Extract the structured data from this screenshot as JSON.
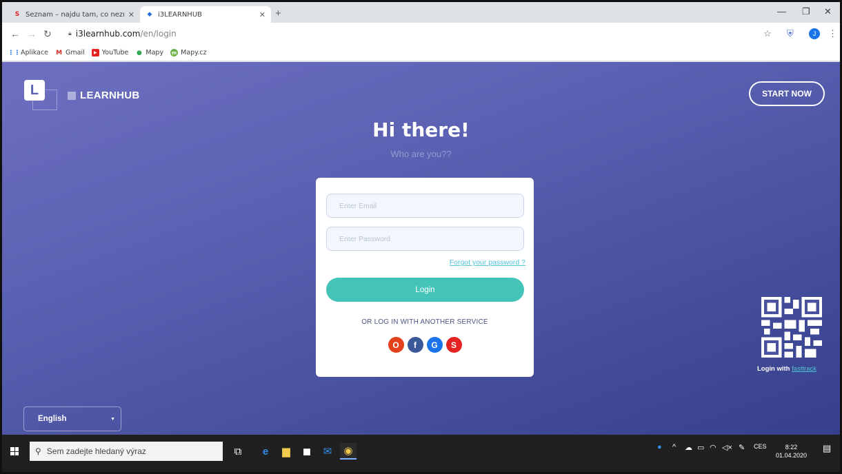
{
  "browser": {
    "tabs": [
      {
        "title": "Seznam – najdu tam, co neznám",
        "favicon": "seznam-icon",
        "active": false
      },
      {
        "title": "i3LEARNHUB",
        "favicon": "i3learnhub-icon",
        "active": true
      }
    ],
    "new_tab": "+",
    "url_host": "i3learnhub.com",
    "url_path": "/en/login",
    "bookmarks": [
      {
        "label": "Aplikace",
        "icon": "apps-grid-icon"
      },
      {
        "label": "Gmail",
        "icon": "gmail-icon"
      },
      {
        "label": "YouTube",
        "icon": "youtube-icon"
      },
      {
        "label": "Mapy",
        "icon": "maps-pin-icon"
      },
      {
        "label": "Mapy.cz",
        "icon": "mapycz-icon"
      }
    ],
    "profile_initial": "J"
  },
  "page": {
    "brand": "LEARNHUB",
    "start_now": "START NOW",
    "heading": "Hi there!",
    "subheading": "Who are you??",
    "email_placeholder": "Enter Email",
    "password_placeholder": "Enter Password",
    "forgot": "Forgot your password ?",
    "login": "Login",
    "or_service": "OR LOG IN WITH ANOTHER SERVICE",
    "socials": [
      {
        "name": "office",
        "glyph": "O",
        "color": "#e3421c"
      },
      {
        "name": "facebook",
        "glyph": "f",
        "color": "#3b5998"
      },
      {
        "name": "google",
        "glyph": "G",
        "color": "#1a73e8"
      },
      {
        "name": "seznam",
        "glyph": "S",
        "color": "#e52222"
      }
    ],
    "qr_caption": "Login with",
    "qr_link": "fasttrack",
    "language": "English"
  },
  "taskbar": {
    "search_placeholder": "Sem zadejte hledaný výraz",
    "lang_indicator": "CES",
    "time": "8:22",
    "date": "01.04.2020"
  },
  "colors": {
    "accent": "#44c4b8",
    "link": "#4fc3d9",
    "bg_top": "#6e6fc0",
    "bg_bottom": "#36408b"
  }
}
